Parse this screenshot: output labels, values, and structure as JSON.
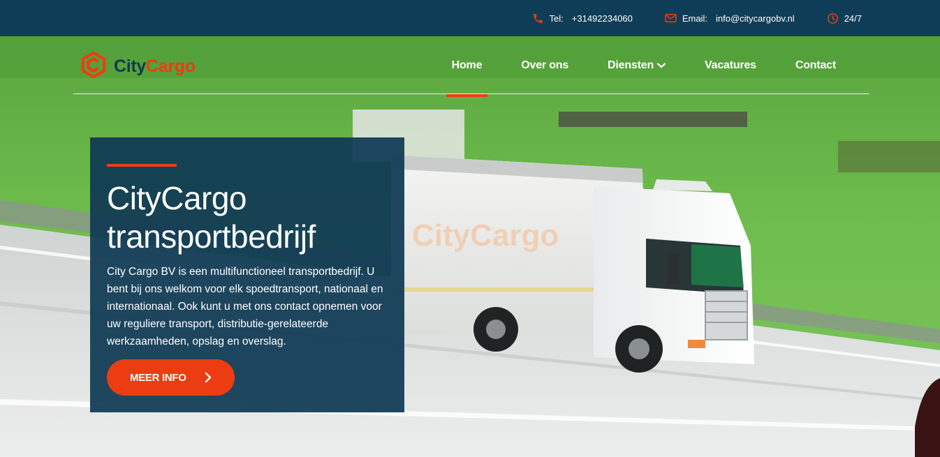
{
  "topbar": {
    "phone_label": "Tel:",
    "phone_value": "+31492234060",
    "email_label": "Email:",
    "email_value": "info@citycargobv.nl",
    "hours": "24/7",
    "icons": [
      "phone-icon",
      "mail-icon",
      "clock-icon"
    ]
  },
  "brand": {
    "name_part1": "City",
    "name_part2": "Cargo"
  },
  "nav": {
    "items": [
      {
        "label": "Home",
        "active": true
      },
      {
        "label": "Over ons",
        "active": false
      },
      {
        "label": "Diensten",
        "active": false,
        "has_dropdown": true
      },
      {
        "label": "Vacatures",
        "active": false
      },
      {
        "label": "Contact",
        "active": false
      }
    ]
  },
  "hero": {
    "title": "CityCargo transportbedrijf",
    "body": "City Cargo BV is een multifunctioneel transportbedrijf. U bent bij ons welkom voor elk spoedtransport, nationaal en internationaal. Ook kunt u met ons contact opnemen voor uw reguliere transport, distributie-gerelateerde werkzaamheden, opslag en overslag.",
    "cta_label": "MEER INFO",
    "truck_lettering": "CityCargo"
  },
  "colors": {
    "brand_dark": "#0f3d57",
    "brand_accent": "#ec3d12",
    "card_bg": "#0f3954"
  }
}
